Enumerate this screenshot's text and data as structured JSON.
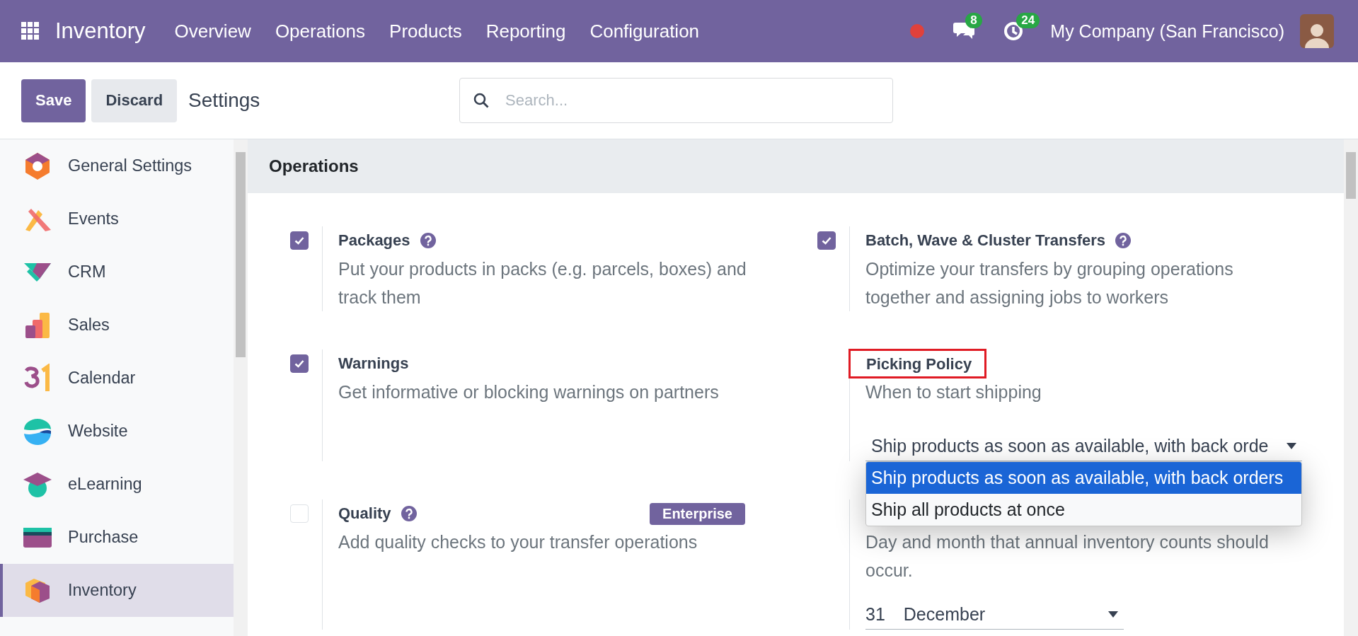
{
  "topbar": {
    "app": "Inventory",
    "menu": [
      "Overview",
      "Operations",
      "Products",
      "Reporting",
      "Configuration"
    ],
    "messages_count": "8",
    "activities_count": "24",
    "company": "My Company (San Francisco)"
  },
  "control_panel": {
    "save": "Save",
    "discard": "Discard",
    "title": "Settings",
    "search": {
      "placeholder": "Search..."
    }
  },
  "sidebar": {
    "items": [
      {
        "label": "General Settings",
        "selected": false
      },
      {
        "label": "Events",
        "selected": false
      },
      {
        "label": "CRM",
        "selected": false
      },
      {
        "label": "Sales",
        "selected": false
      },
      {
        "label": "Calendar",
        "selected": false
      },
      {
        "label": "Website",
        "selected": false
      },
      {
        "label": "eLearning",
        "selected": false
      },
      {
        "label": "Purchase",
        "selected": false
      },
      {
        "label": "Inventory",
        "selected": true
      }
    ]
  },
  "section": {
    "title": "Operations",
    "settings": [
      {
        "kind": "checkbox",
        "title": "Packages",
        "checked": true,
        "help": true,
        "description": "Put your products in packs (e.g. parcels, boxes) and track them"
      },
      {
        "kind": "checkbox",
        "title": "Batch, Wave & Cluster Transfers",
        "checked": true,
        "help": true,
        "description": "Optimize your transfers by grouping operations together and assigning jobs to workers"
      },
      {
        "kind": "checkbox",
        "title": "Warnings",
        "checked": true,
        "description": "Get informative or blocking warnings on partners"
      },
      {
        "kind": "select",
        "title": "Picking Policy",
        "highlighted": true,
        "description": "When to start shipping",
        "value": "Ship products as soon as available, with back orde",
        "expanded": true,
        "options": [
          {
            "label": "Ship products as soon as available, with back orders",
            "selected": true
          },
          {
            "label": "Ship all products at once",
            "selected": false
          }
        ]
      },
      {
        "kind": "checkbox",
        "title": "Quality",
        "checked": false,
        "help": true,
        "badge": "Enterprise",
        "description": "Add quality checks to your transfer operations"
      },
      {
        "kind": "date",
        "description": "Day and month that annual inventory counts should occur.",
        "day": "31",
        "month": "December"
      }
    ]
  }
}
